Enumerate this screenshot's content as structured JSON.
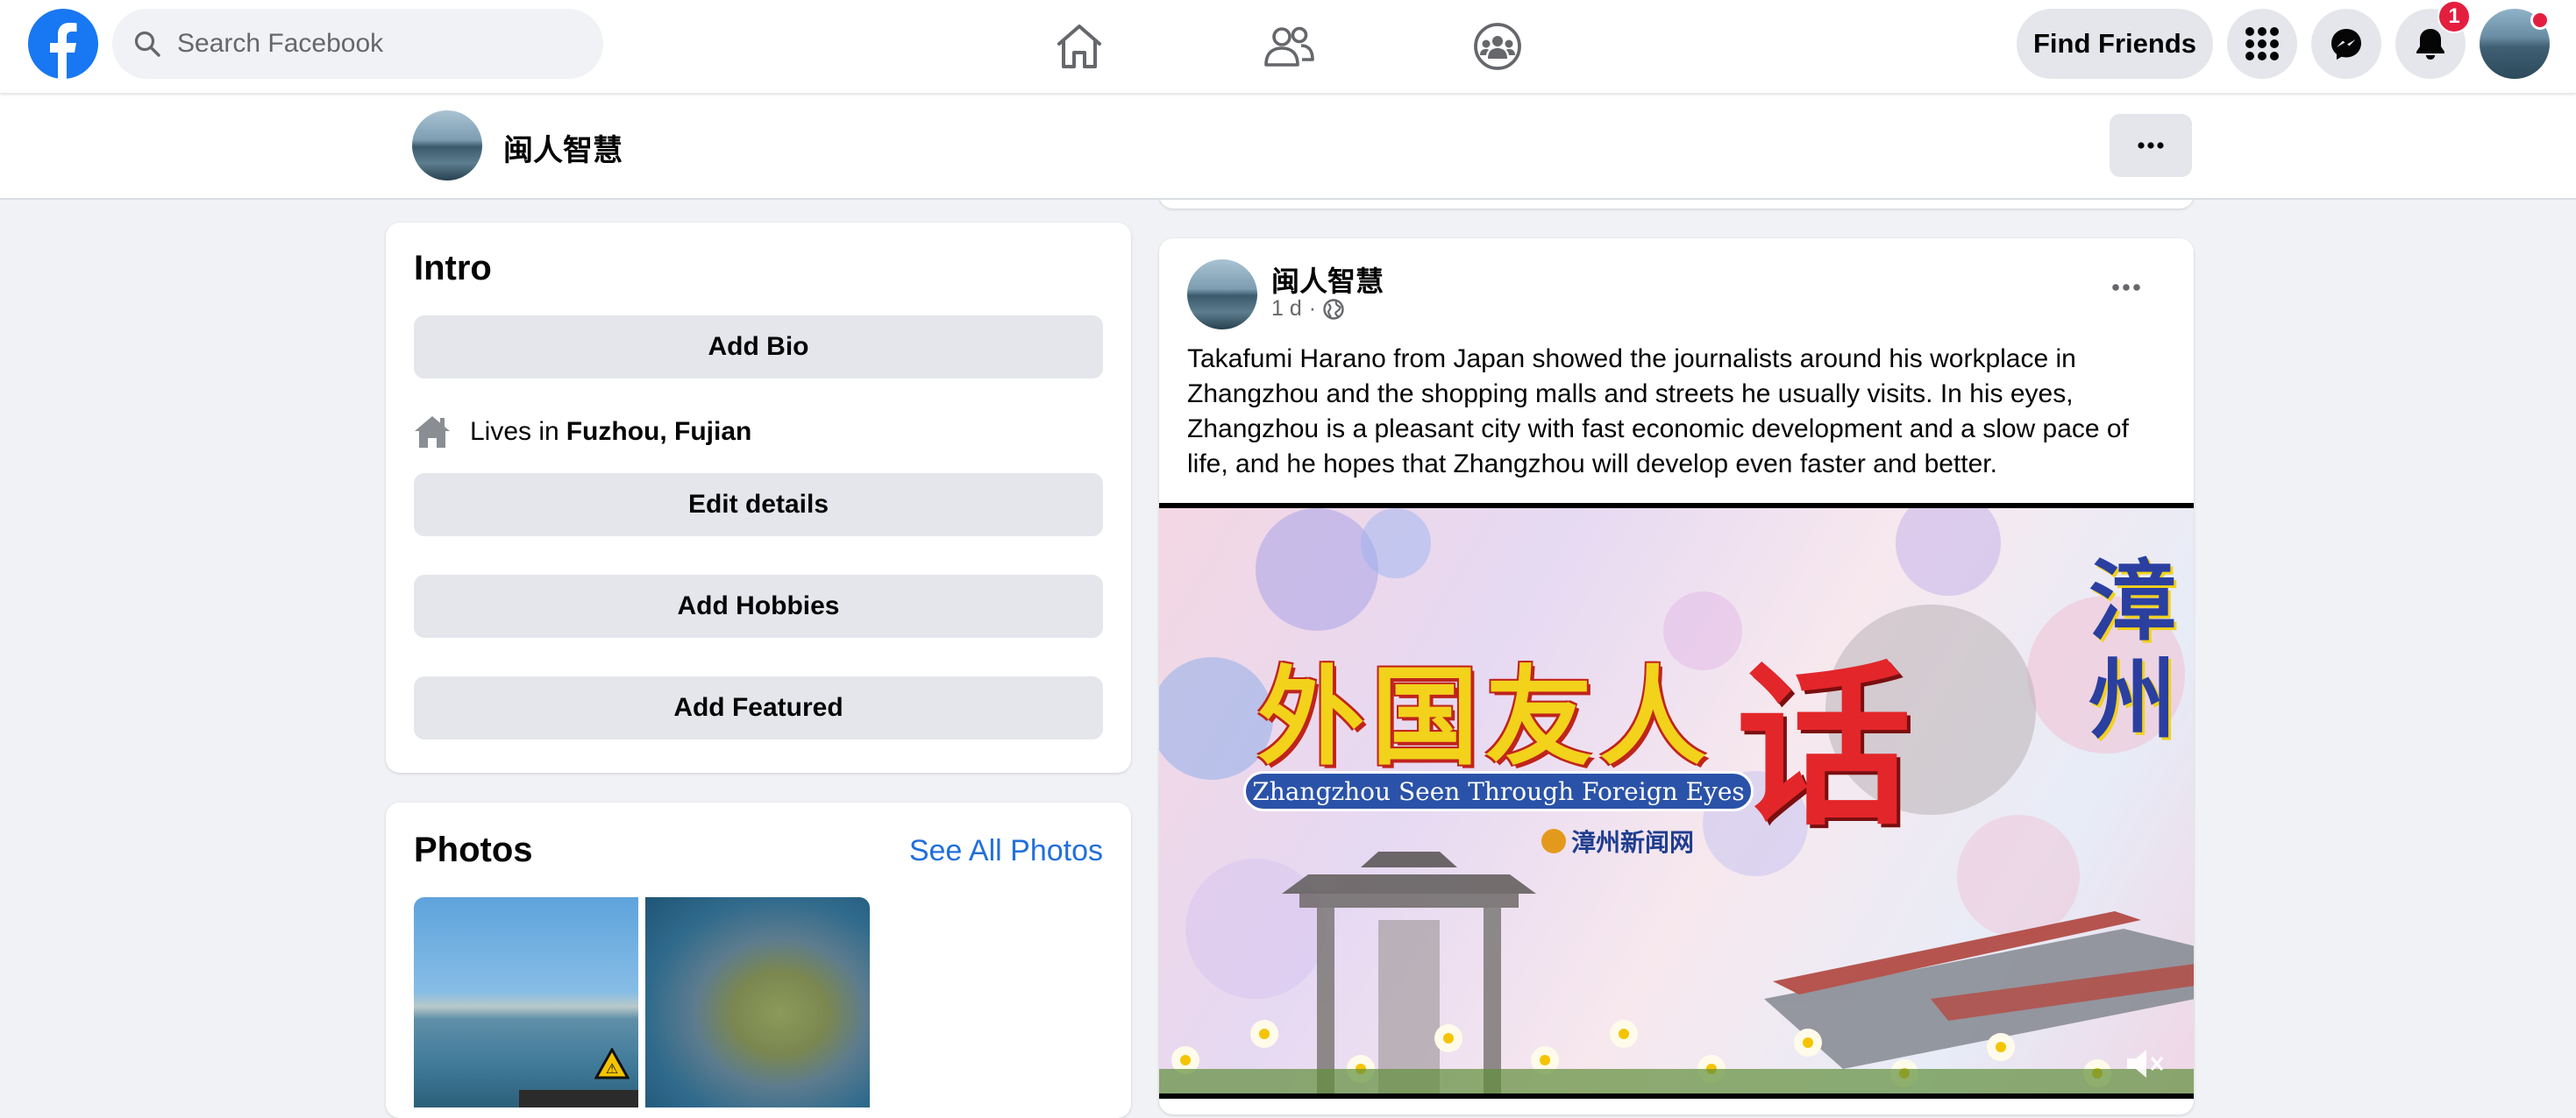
{
  "nav": {
    "search_placeholder": "Search Facebook",
    "find_friends_label": "Find Friends",
    "notification_count": "1",
    "icons": [
      "facebook-logo",
      "search-icon",
      "home-icon",
      "friends-icon",
      "groups-icon",
      "menu-grid-icon",
      "messenger-icon",
      "bell-icon"
    ]
  },
  "profile_header": {
    "name": "闽人智慧"
  },
  "intro": {
    "title": "Intro",
    "add_bio_label": "Add Bio",
    "lives_prefix": "Lives in",
    "lives_city": "Fuzhou, Fujian",
    "edit_details_label": "Edit details",
    "add_hobbies_label": "Add Hobbies",
    "add_featured_label": "Add Featured"
  },
  "photos": {
    "title": "Photos",
    "see_all_label": "See All Photos"
  },
  "post": {
    "author": "闽人智慧",
    "time": "1 d",
    "separator": "·",
    "text": "Takafumi Harano from Japan showed the journalists around his workplace in Zhangzhou and the shopping malls and streets he usually visits. In his eyes, Zhangzhou is a pleasant city with fast economic development and a slow pace of life, and he hopes that Zhangzhou will develop even faster and better.",
    "video": {
      "title_cn": "外国友人",
      "big_char": "话",
      "side_chars": "漳州",
      "banner": "Zhangzhou Seen Through Foreign Eyes",
      "logo_text": "漳州新闻网"
    }
  },
  "colors": {
    "brand_blue": "#1877f2",
    "link_blue": "#216fdb",
    "button_gray": "#e4e6eb",
    "page_bg": "#f0f2f5",
    "badge_red": "#e41e3f"
  }
}
